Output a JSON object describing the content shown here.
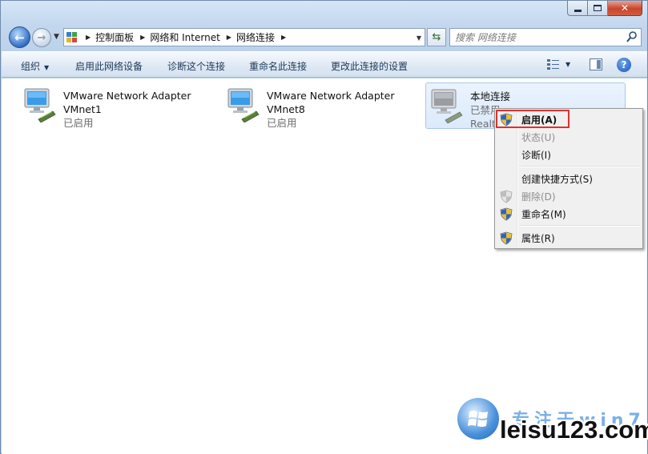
{
  "breadcrumb": [
    {
      "label": "控制面板"
    },
    {
      "label": "网络和 Internet"
    },
    {
      "label": "网络连接"
    }
  ],
  "search": {
    "placeholder": "搜索 网络连接"
  },
  "toolbar": {
    "organize": "组织",
    "enable_device": "启用此网络设备",
    "diagnose": "诊断这个连接",
    "rename": "重命名此连接",
    "change_settings": "更改此连接的设置"
  },
  "connections": [
    {
      "name": "VMware Network Adapter",
      "sub": "VMnet1",
      "state": "已启用"
    },
    {
      "name": "VMware Network Adapter",
      "sub": "VMnet8",
      "state": "已启用"
    },
    {
      "name": "本地连接",
      "sub": "",
      "state": "已禁用",
      "adapter": "Realt"
    }
  ],
  "context_menu": {
    "items": [
      {
        "label": "启用(A)",
        "bold": true,
        "disabled": false,
        "shield": true
      },
      {
        "label": "状态(U)",
        "disabled": true,
        "shield": false
      },
      {
        "label": "诊断(I)",
        "disabled": false,
        "shield": false
      },
      {
        "label": "创建快捷方式(S)",
        "disabled": false,
        "shield": false
      },
      {
        "label": "删除(D)",
        "disabled": true,
        "shield": true
      },
      {
        "label": "重命名(M)",
        "disabled": false,
        "shield": true
      },
      {
        "label": "属性(R)",
        "disabled": false,
        "shield": true
      }
    ]
  },
  "watermark": {
    "top": "专注于win7",
    "text": "leisu123.com"
  },
  "colors": {
    "highlight_box": "#e0312d",
    "command_text": "#1e395b",
    "selection": "#dbeafc"
  }
}
